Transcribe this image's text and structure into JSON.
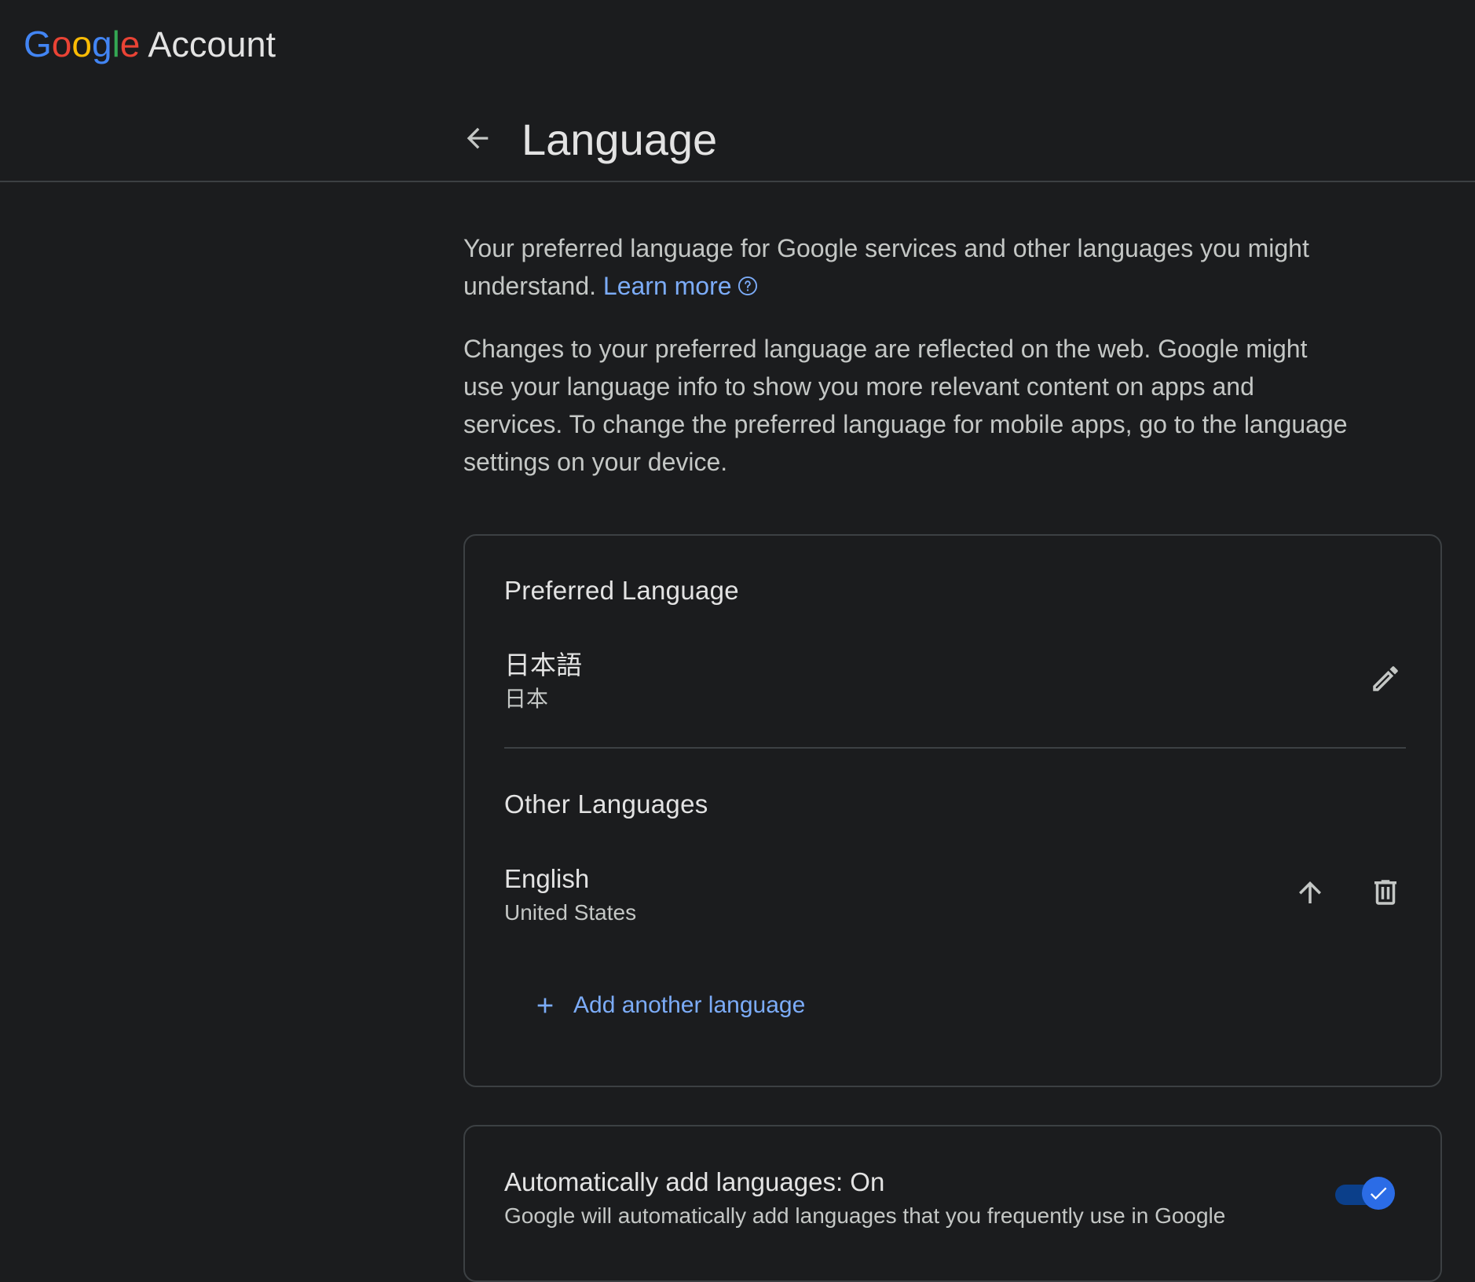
{
  "brand": {
    "letters": [
      "G",
      "o",
      "o",
      "g",
      "l",
      "e"
    ],
    "account": "Account"
  },
  "header": {
    "title": "Language",
    "back_icon": "arrow-left-icon"
  },
  "intro": {
    "line1": "Your preferred language for Google services and other languages you might understand.",
    "learn_more": "Learn more",
    "paragraph2": "Changes to your preferred language are reflected on the web. Google might use your language info to show you more relevant content on apps and services. To change the preferred language for mobile apps, go to the language settings on your device."
  },
  "preferred": {
    "title": "Preferred Language",
    "language": "日本語",
    "region": "日本",
    "edit_icon": "pencil-icon"
  },
  "other": {
    "title": "Other Languages",
    "items": [
      {
        "language": "English",
        "region": "United States"
      }
    ],
    "add_label": "Add another language"
  },
  "auto": {
    "title": "Automatically add languages: On",
    "description": "Google will automatically add languages that you frequently use in Google",
    "enabled": true
  },
  "colors": {
    "background": "#1b1c1e",
    "link": "#7cacf8",
    "toggle_thumb": "#2b6ce6",
    "toggle_track": "#0b3f8a"
  }
}
